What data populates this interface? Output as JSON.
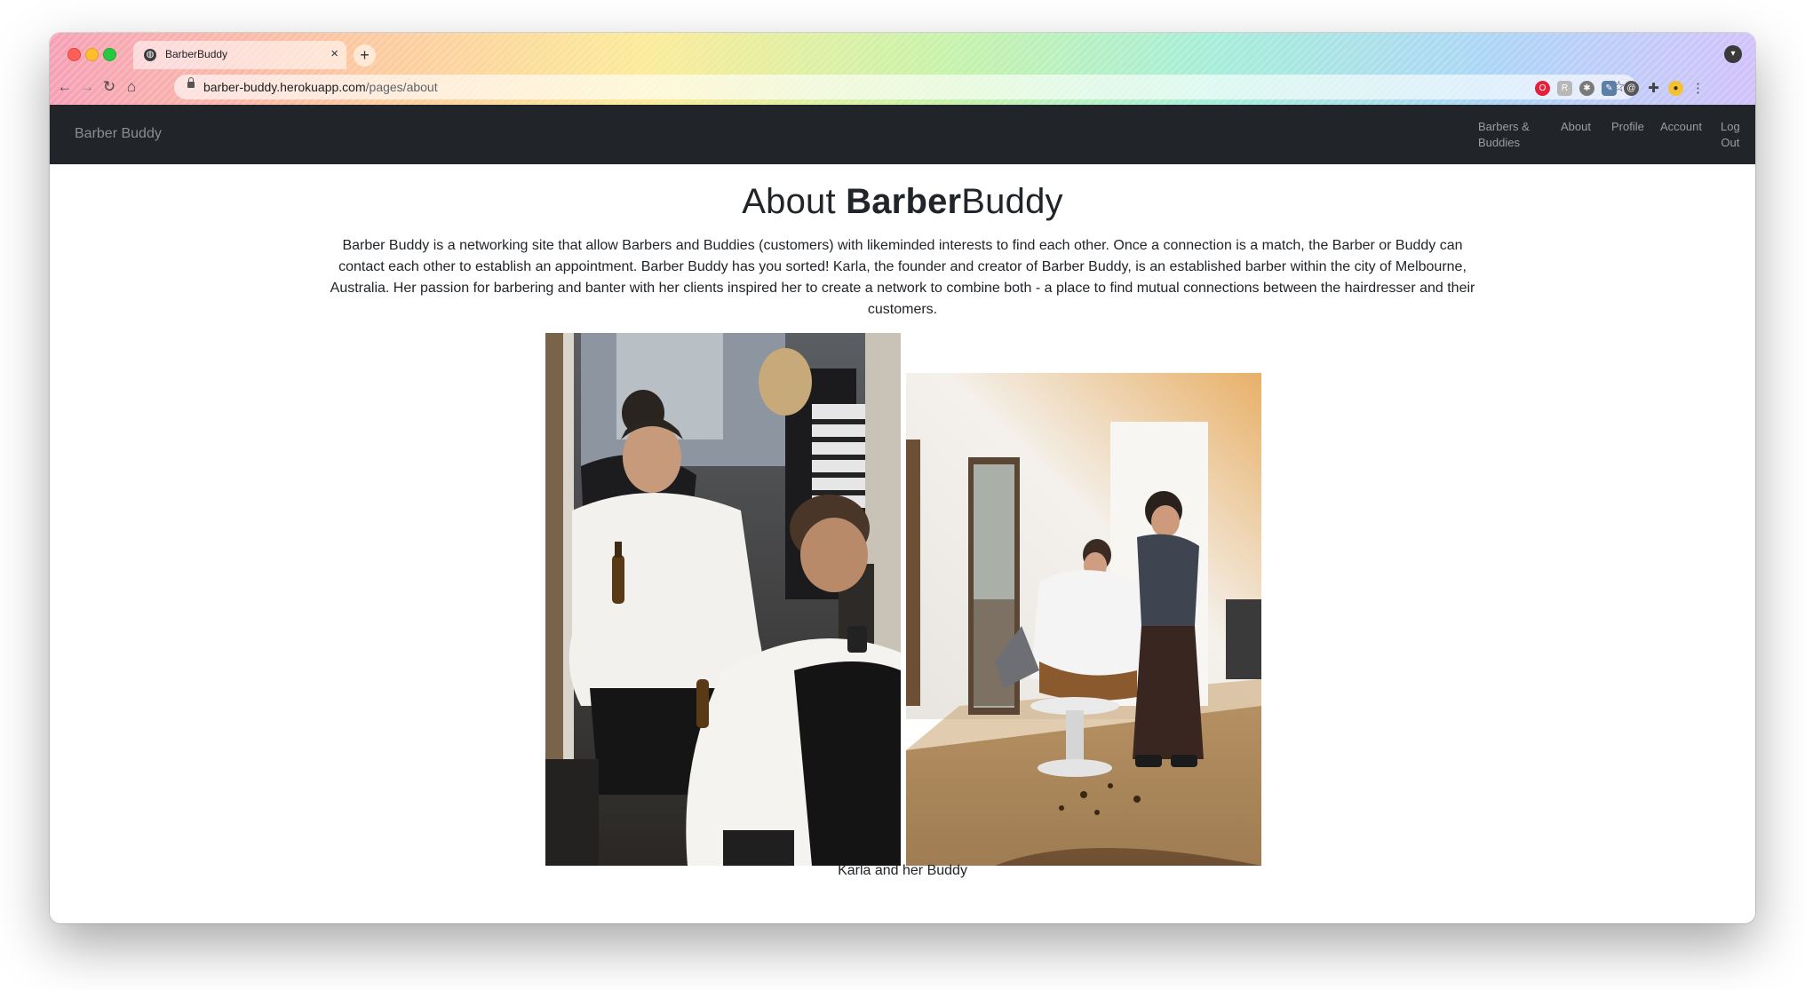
{
  "browser": {
    "tab_title": "BarberBuddy",
    "tab_close": "×",
    "new_tab": "+",
    "url_host": "barber-buddy.herokuapp.com",
    "url_path": "/pages/about"
  },
  "site": {
    "brand": "Barber Buddy",
    "nav": {
      "barbers_line1": "Barbers &",
      "barbers_line2": "Buddies",
      "about": "About",
      "profile": "Profile",
      "account": "Account",
      "logout_line1": "Log",
      "logout_line2": "Out"
    }
  },
  "page": {
    "title_prefix": "About ",
    "title_bold": "Barber",
    "title_suffix": "Buddy",
    "intro": "Barber Buddy is a networking site that allow Barbers and Buddies (customers) with likeminded interests to find each other. Once a connection is a match, the Barber or Buddy can contact each other to establish an appointment. Barber Buddy has you sorted! Karla, the founder and creator of Barber Buddy, is an established barber within the city of Melbourne, Australia. Her passion for barbering and banter with her clients inspired her to create a network to combine both - a place to find mutual connections between the hairdresser and their customers.",
    "caption": "Karla and her Buddy"
  },
  "icons": {
    "back": "back-arrow-icon",
    "forward": "forward-arrow-icon",
    "reload": "reload-icon",
    "home": "home-icon",
    "lock": "lock-icon",
    "star": "bookmark-star-icon",
    "extensions": "puzzle-icon",
    "menu": "kebab-menu-icon"
  }
}
